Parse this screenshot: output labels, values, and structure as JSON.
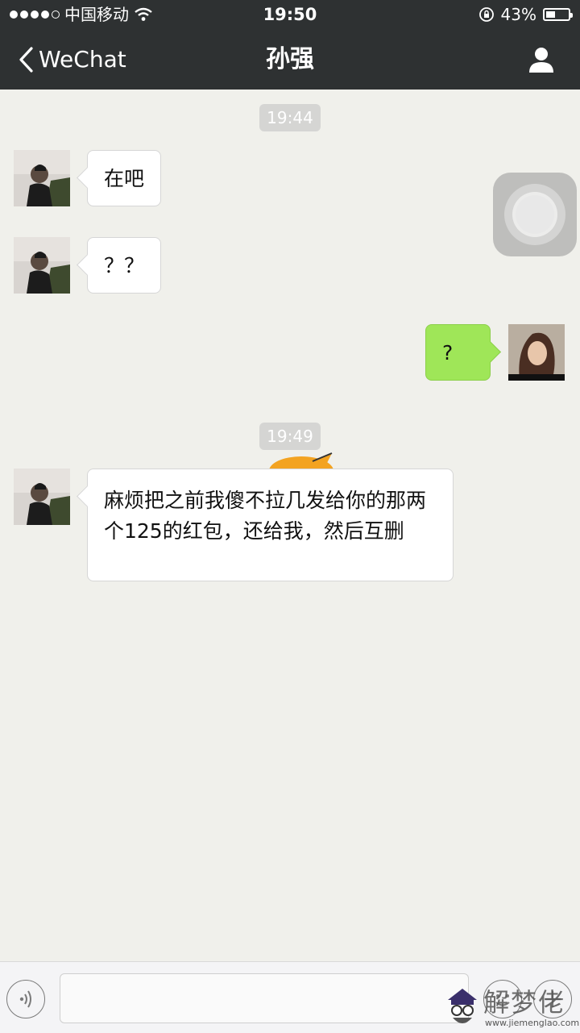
{
  "status_bar": {
    "carrier": "中国移动",
    "time": "19:50",
    "battery": "43%",
    "battery_level": 0.43
  },
  "nav": {
    "back_label": "WeChat",
    "title": "孙强"
  },
  "messages": {
    "ts1": "19:44",
    "m1": "在吧",
    "m2": "？？",
    "m3": "?",
    "ts2": "19:49",
    "m4": "麻烦把之前我傻不拉几发给你的那两个125的红包，还给我，然后互删"
  },
  "watermark": {
    "text": "解梦佬",
    "url": "www.jiemenglao.com"
  },
  "colors": {
    "nav_bg": "#2e3132",
    "chat_bg": "#f0f0eb",
    "sent_bubble": "#9fe658",
    "recv_bubble": "#ffffff"
  }
}
